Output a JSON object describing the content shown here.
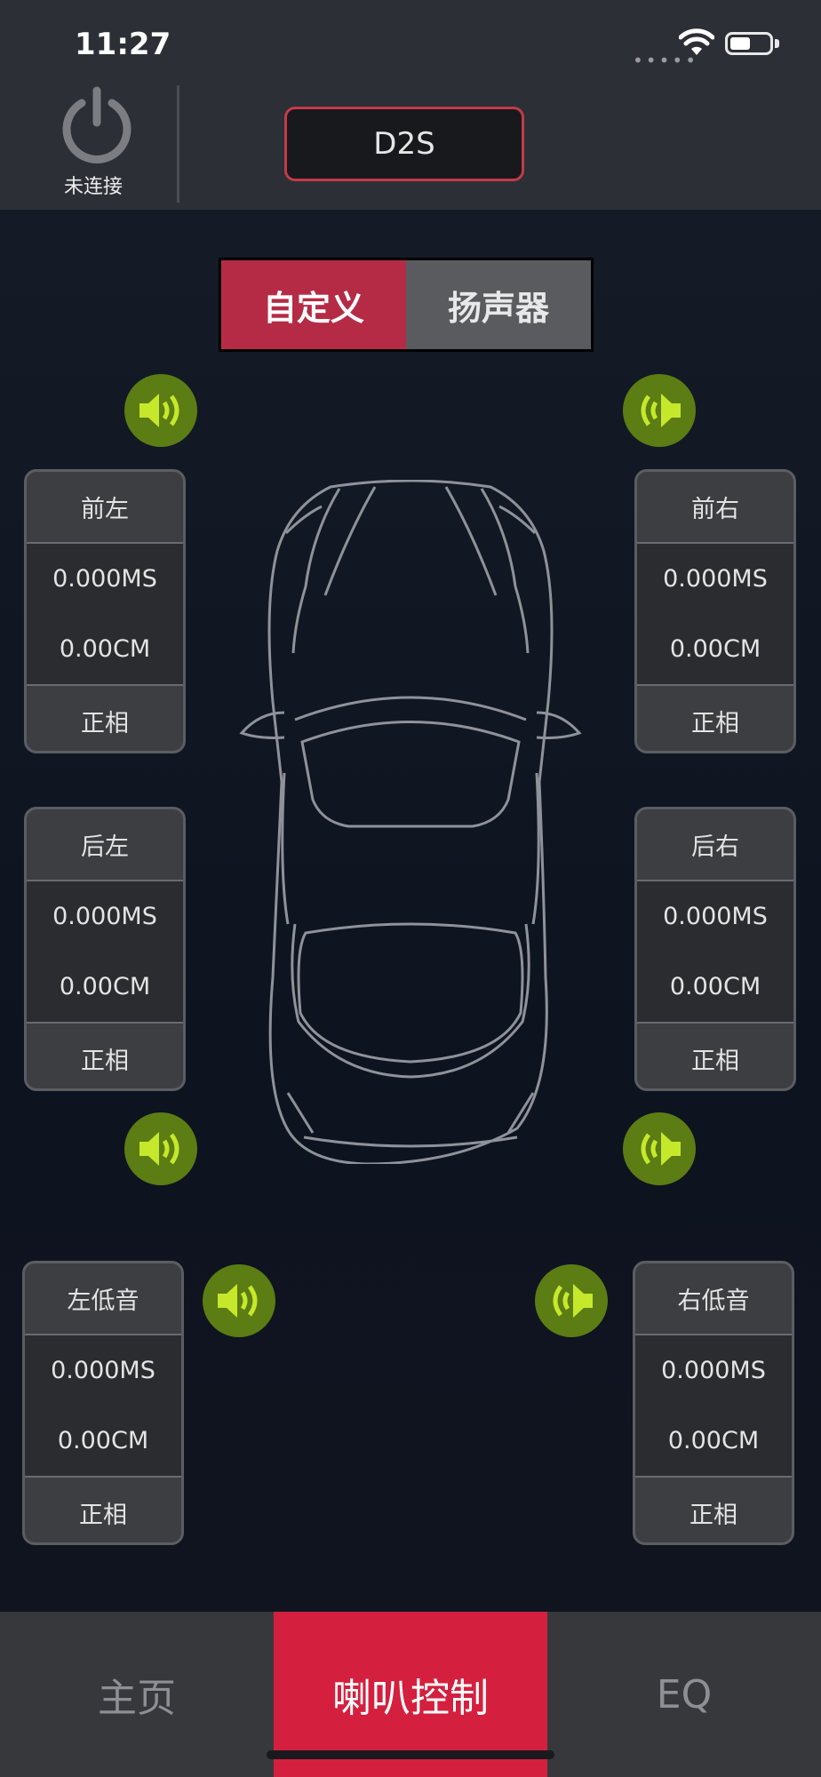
{
  "status_bar": {
    "time": "11:27",
    "signal_dots": "•••••"
  },
  "header": {
    "power_label": "未连接",
    "device_name": "D2S"
  },
  "segment": {
    "options": [
      "自定义",
      "扬声器"
    ],
    "selected": "自定义"
  },
  "channels": [
    {
      "name": "前左",
      "delay": "0.000MS",
      "distance": "0.00CM",
      "phase": "正相"
    },
    {
      "name": "前右",
      "delay": "0.000MS",
      "distance": "0.00CM",
      "phase": "正相"
    },
    {
      "name": "后左",
      "delay": "0.000MS",
      "distance": "0.00CM",
      "phase": "正相"
    },
    {
      "name": "后右",
      "delay": "0.000MS",
      "distance": "0.00CM",
      "phase": "正相"
    },
    {
      "name": "左低音",
      "delay": "0.000MS",
      "distance": "0.00CM",
      "phase": "正相"
    },
    {
      "name": "右低音",
      "delay": "0.000MS",
      "distance": "0.00CM",
      "phase": "正相"
    }
  ],
  "tabs": [
    {
      "label": "主页",
      "active": false
    },
    {
      "label": "喇叭控制",
      "active": true
    },
    {
      "label": "EQ",
      "active": false
    }
  ],
  "icons": {
    "speaker": "speaker-icon",
    "power": "power-icon",
    "car": "car-top-view",
    "wifi": "wifi-icon",
    "battery": "battery-icon"
  },
  "colors": {
    "accent": "#d4203e",
    "segment_active": "#b52b45",
    "speaker_icon_bg": "#5b7d14",
    "speaker_icon_fg": "#c6e82a"
  }
}
